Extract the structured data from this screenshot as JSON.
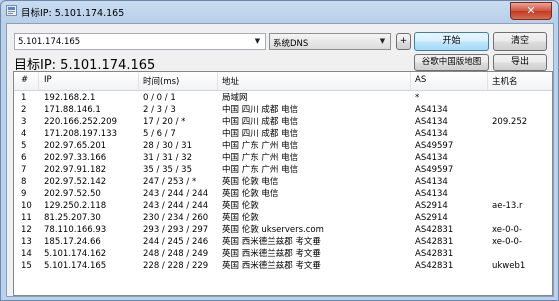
{
  "window": {
    "title": "目标IP: 5.101.174.165",
    "close_label": "✕"
  },
  "toolbar": {
    "ip_value": "5.101.174.165",
    "dns_value": "系统DNS",
    "plus_label": "+",
    "start_label": "开始",
    "clear_label": "清空",
    "map_label": "谷歌中国版地图",
    "export_label": "导出"
  },
  "target_ip_label": "目标IP:  5.101.174.165",
  "table": {
    "headers": [
      "#",
      "IP",
      "时间(ms)",
      "地址",
      "AS",
      "主机名"
    ],
    "rows": [
      [
        "1",
        "192.168.2.1",
        "0 / 0 / 1",
        "局域网",
        "*",
        ""
      ],
      [
        "2",
        "171.88.146.1",
        "2 / 3 / 3",
        "中国 四川 成都 电信",
        "AS4134",
        ""
      ],
      [
        "3",
        "220.166.252.209",
        "17 / 20 / *",
        "中国 四川 成都 电信",
        "AS4134",
        "209.252"
      ],
      [
        "4",
        "171.208.197.133",
        "5 / 6 / 7",
        "中国 四川 成都 电信",
        "AS4134",
        ""
      ],
      [
        "5",
        "202.97.65.201",
        "28 / 30 / 31",
        "中国 广东 广州 电信",
        "AS49597",
        ""
      ],
      [
        "6",
        "202.97.33.166",
        "31 / 31 / 32",
        "中国 广东 广州 电信",
        "AS4134",
        ""
      ],
      [
        "7",
        "202.97.91.182",
        "35 / 35 / 35",
        "中国 广东 广州 电信",
        "AS49597",
        ""
      ],
      [
        "8",
        "202.97.52.142",
        "247 / 253 / *",
        "英国 伦敦 电信",
        "AS4134",
        ""
      ],
      [
        "9",
        "202.97.52.50",
        "243 / 244 / 244",
        "英国 伦敦 电信",
        "AS4134",
        ""
      ],
      [
        "10",
        "129.250.2.118",
        "243 / 244 / 244",
        "英国 伦敦",
        "AS2914",
        "ae-13.r"
      ],
      [
        "11",
        "81.25.207.30",
        "230 / 234 / 260",
        "英国 伦敦",
        "AS2914",
        ""
      ],
      [
        "12",
        "78.110.166.93",
        "293 / 293 / 297",
        "英国 伦敦 ukservers.com",
        "AS42831",
        "xe-0-0-"
      ],
      [
        "13",
        "185.17.24.66",
        "244 / 245 / 246",
        "英国 西米德兰兹郡 考文垂",
        "AS42831",
        "xe-0-0-"
      ],
      [
        "14",
        "5.101.174.162",
        "248 / 248 / 249",
        "英国 西米德兰兹郡 考文垂",
        "AS42831",
        ""
      ],
      [
        "15",
        "5.101.174.165",
        "228 / 228 / 229",
        "英国 西米德兰兹郡 考文垂",
        "AS42831",
        "ukweb1"
      ]
    ]
  }
}
